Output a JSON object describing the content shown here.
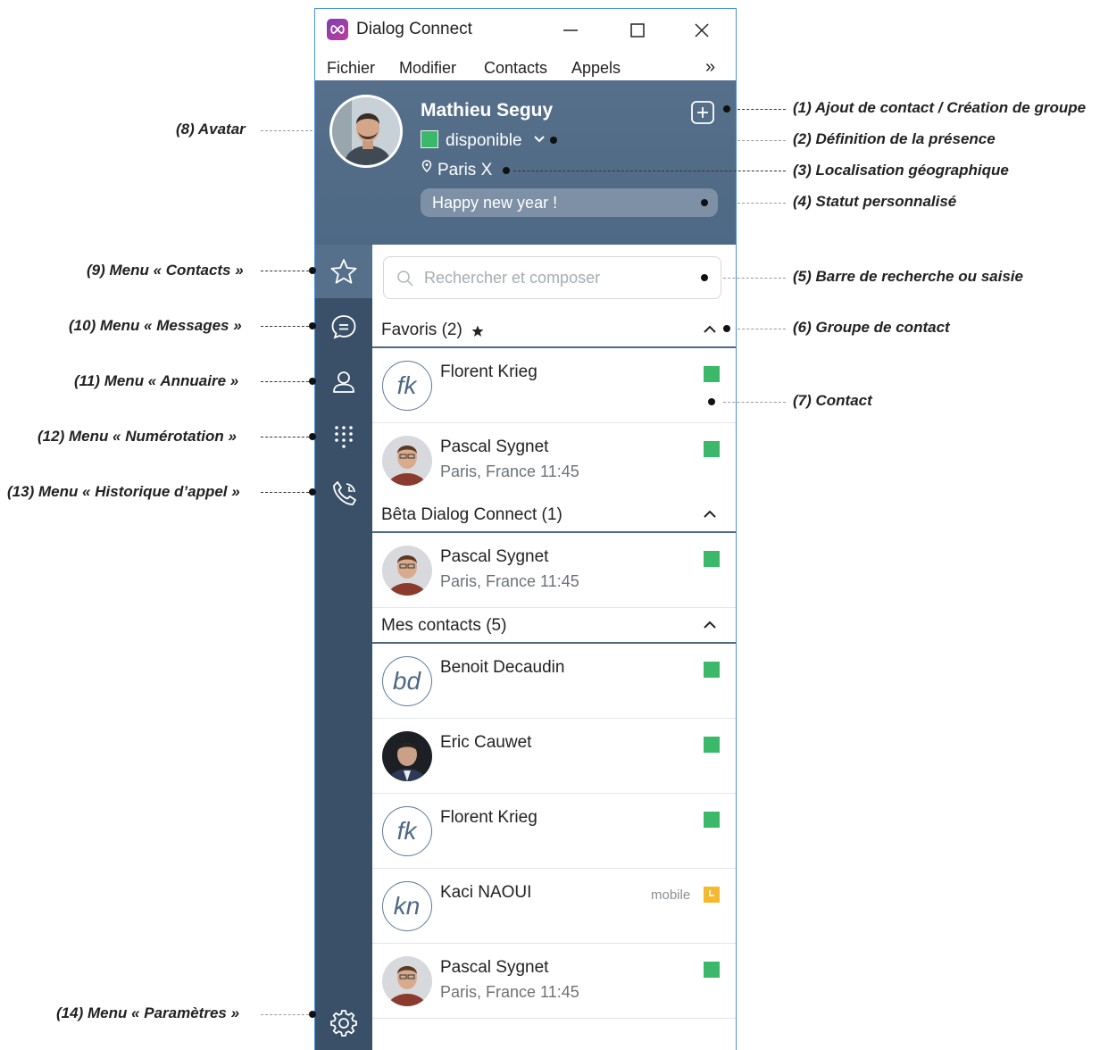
{
  "window": {
    "title": "Dialog Connect"
  },
  "menubar": {
    "items": [
      "Fichier",
      "Modifier",
      "Contacts",
      "Appels"
    ],
    "more": "»"
  },
  "profile": {
    "name": "Mathieu Seguy",
    "presence": "disponible",
    "location": "Paris X",
    "status_message": "Happy new year !"
  },
  "search": {
    "placeholder": "Rechercher et composer"
  },
  "groups": [
    {
      "label": "Favoris (2)",
      "contacts": [
        {
          "name": "Florent Krieg",
          "initials": "fk",
          "sub": "",
          "presence": "available"
        },
        {
          "name": "Pascal Sygnet",
          "initials": "",
          "sub": "Paris, France 11:45",
          "presence": "available"
        }
      ]
    },
    {
      "label": "Bêta Dialog Connect (1)",
      "contacts": [
        {
          "name": "Pascal Sygnet",
          "initials": "",
          "sub": "Paris, France 11:45",
          "presence": "available"
        }
      ]
    },
    {
      "label": "Mes contacts (5)",
      "contacts": [
        {
          "name": "Benoit Decaudin",
          "initials": "bd",
          "sub": "",
          "presence": "available"
        },
        {
          "name": "Eric Cauwet",
          "initials": "",
          "sub": "",
          "presence": "available"
        },
        {
          "name": "Florent Krieg",
          "initials": "fk",
          "sub": "",
          "presence": "available"
        },
        {
          "name": "Kaci NAOUI",
          "initials": "kn",
          "sub": "",
          "presence": "mobile",
          "device": "mobile"
        },
        {
          "name": "Pascal Sygnet",
          "initials": "",
          "sub": "Paris, France 11:45",
          "presence": "available"
        }
      ]
    }
  ],
  "nav": [
    "star-icon",
    "message-icon",
    "user-icon",
    "dialpad-icon",
    "phone-history-icon",
    "gear-icon"
  ],
  "annotations": {
    "a1": "(1) Ajout de contact / Création de groupe",
    "a2": "(2) Définition de la présence",
    "a3": "(3) Localisation géographique",
    "a4": "(4) Statut personnalisé",
    "a5": "(5) Barre de recherche ou saisie",
    "a6": "(6) Groupe de contact",
    "a7": "(7) Contact",
    "a8": "(8) Avatar",
    "a9": "(9) Menu « Contacts »",
    "a10": "(10) Menu « Messages »",
    "a11": "(11) Menu « Annuaire »",
    "a12": "(12) Menu « Numérotation »",
    "a13": "(13) Menu « Historique d’appel »",
    "a14": "(14) Menu « Paramètres »"
  },
  "colors": {
    "header": "#566f8a",
    "nav": "#3a5068",
    "available": "#3cb86a",
    "mobile": "#f5b82e"
  }
}
